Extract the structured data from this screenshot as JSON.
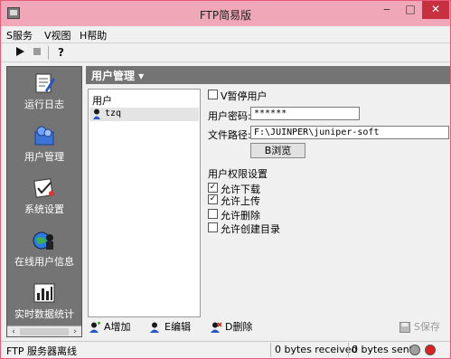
{
  "window": {
    "title": "FTP简易版",
    "min": "‒",
    "max": "□",
    "close": "✕"
  },
  "menu": {
    "items": [
      "S服务",
      "V视图",
      "H帮助"
    ]
  },
  "toolbar": {
    "play_icon": "play-icon",
    "stop_icon": "stop-icon",
    "help_icon": "help-icon"
  },
  "sidebar": {
    "items": [
      {
        "label": "运行日志",
        "icon": "log-icon"
      },
      {
        "label": "用户管理",
        "icon": "users-icon"
      },
      {
        "label": "系统设置",
        "icon": "settings-icon"
      },
      {
        "label": "在线用户信息",
        "icon": "online-users-icon"
      },
      {
        "label": "实时数据统计",
        "icon": "statistics-icon"
      }
    ],
    "left_arrow": "‹",
    "right_arrow": "›"
  },
  "panel": {
    "title": "用户管理 ▾"
  },
  "user_list": {
    "header": "用户",
    "users": [
      "tzq"
    ]
  },
  "form": {
    "pause_label": "V暂停用户",
    "pause_checked": false,
    "password_label": "用户密码:",
    "password_value": "******",
    "path_label": "文件路径:",
    "path_value": "F:\\JUINPER\\juniper-soft",
    "browse_label": "B浏览",
    "permissions_title": "用户权限设置",
    "permissions": [
      {
        "label": "允许下载",
        "checked": true
      },
      {
        "label": "允许上传",
        "checked": true
      },
      {
        "label": "允许删除",
        "checked": false
      },
      {
        "label": "允许创建目录",
        "checked": false
      }
    ]
  },
  "actions": {
    "add_label": "A增加",
    "edit_label": "E编辑",
    "delete_label": "D删除",
    "save_label": "S保存"
  },
  "status": {
    "server_state": "FTP 服务器离线",
    "received": "0 bytes received",
    "sent": "0 bytes sent",
    "led_idle_color": "#a0a0a0",
    "led_active_color": "#e02020"
  }
}
